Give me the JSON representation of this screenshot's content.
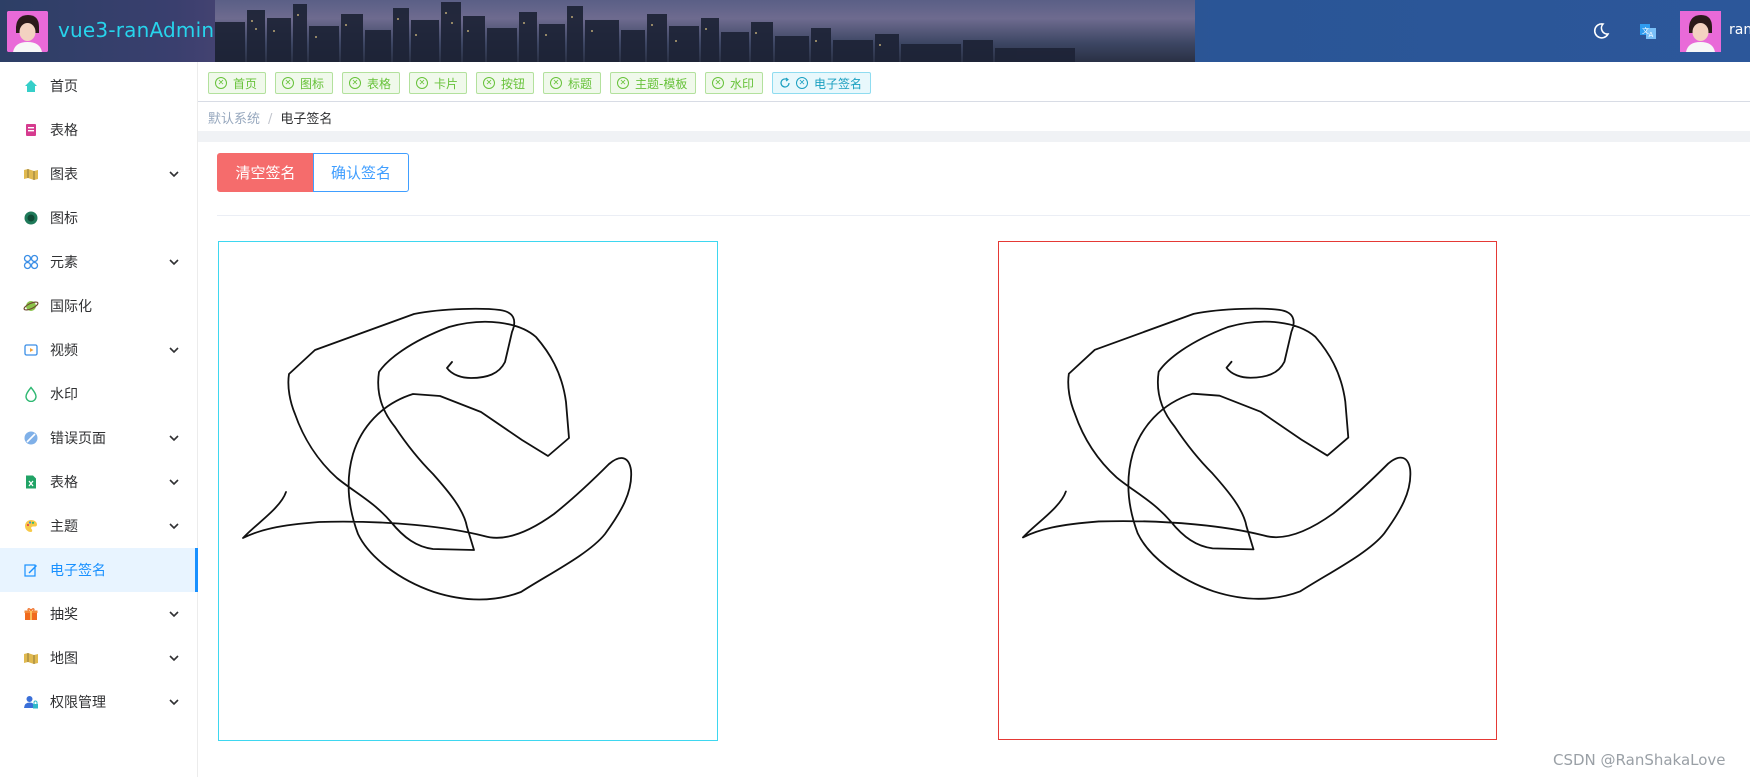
{
  "header": {
    "app_title": "vue3-ranAdmin",
    "user_name": "ran",
    "icons": [
      "moon-icon",
      "translate-icon"
    ]
  },
  "sidebar": {
    "items": [
      {
        "label": "首页",
        "icon": "home-icon",
        "expandable": false
      },
      {
        "label": "表格",
        "icon": "document-icon",
        "expandable": false
      },
      {
        "label": "图表",
        "icon": "map-icon",
        "expandable": true
      },
      {
        "label": "图标",
        "icon": "circle-icon",
        "expandable": false
      },
      {
        "label": "元素",
        "icon": "grid-icon",
        "expandable": true
      },
      {
        "label": "国际化",
        "icon": "planet-icon",
        "expandable": false
      },
      {
        "label": "视频",
        "icon": "video-icon",
        "expandable": true
      },
      {
        "label": "水印",
        "icon": "drop-icon",
        "expandable": false
      },
      {
        "label": "错误页面",
        "icon": "forbidden-icon",
        "expandable": true
      },
      {
        "label": "表格",
        "icon": "excel-icon",
        "expandable": true
      },
      {
        "label": "主题",
        "icon": "palette-icon",
        "expandable": true
      },
      {
        "label": "电子签名",
        "icon": "sign-icon",
        "expandable": false,
        "active": true
      },
      {
        "label": "抽奖",
        "icon": "gift-icon",
        "expandable": true
      },
      {
        "label": "地图",
        "icon": "map-icon",
        "expandable": true
      },
      {
        "label": "权限管理",
        "icon": "user-lock-icon",
        "expandable": true
      }
    ]
  },
  "tags": [
    {
      "label": "首页"
    },
    {
      "label": "图标"
    },
    {
      "label": "表格"
    },
    {
      "label": "卡片"
    },
    {
      "label": "按钮"
    },
    {
      "label": "标题"
    },
    {
      "label": "主题-模板"
    },
    {
      "label": "水印"
    },
    {
      "label": "电子签名",
      "current": true
    }
  ],
  "breadcrumb": {
    "root": "默认系统",
    "separator": "/",
    "current": "电子签名"
  },
  "actions": {
    "clear_label": "清空签名",
    "confirm_label": "确认签名"
  },
  "colors": {
    "accent": "#409eff",
    "danger": "#f56c6c",
    "tag_green": "#67c23a",
    "pad_left_border": "#3ed7f0",
    "pad_right_border": "#e53935"
  },
  "watermark": "CSDN @RanShakaLove"
}
